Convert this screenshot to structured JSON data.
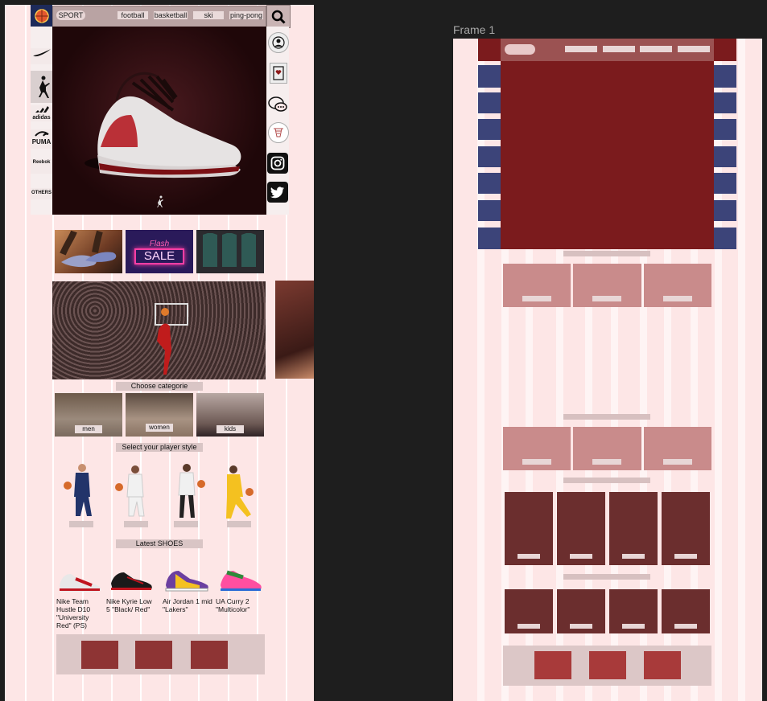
{
  "canvas": {
    "frame_title": "Frame 1"
  },
  "left": {
    "nav": {
      "logo_icon": "sport-ball-logo",
      "brand": "SPORT",
      "links": [
        "football",
        "basketball",
        "ski",
        "ping-pong"
      ],
      "search_icon": "search-icon"
    },
    "brands": [
      "nike",
      "jordan",
      "adidas",
      "PUMA",
      "Reebok",
      "OTHERS"
    ],
    "side_icons": [
      "user-icon",
      "wishlist-icon",
      "chat-icon",
      "basketball-hoop-icon",
      "instagram-icon",
      "twitter-icon"
    ],
    "promo": {
      "sale_top": "Flash",
      "sale_main": "SALE"
    },
    "choose_category": "Choose categorie",
    "categories": [
      "men",
      "women",
      "kids"
    ],
    "select_style": "Select your player style",
    "latest_shoes": "Latest SHOES",
    "shoes": [
      "Nike Team Hustle D10 \"University Red\" (PS)",
      "Nike Kyrie Low 5 \"Black/ Red\"",
      "Air Jordan 1 mid \"Lakers\"",
      "UA Curry 2 \"Multicolor\""
    ]
  },
  "colors": {
    "frame_bg": "#fde6e6",
    "wire_red": "#7b1b1d",
    "wire_navy": "#3c4479",
    "wire_mid": "#c98b8b",
    "wire_dark": "#6b2e2e",
    "footer_btn": "#8e3434"
  }
}
